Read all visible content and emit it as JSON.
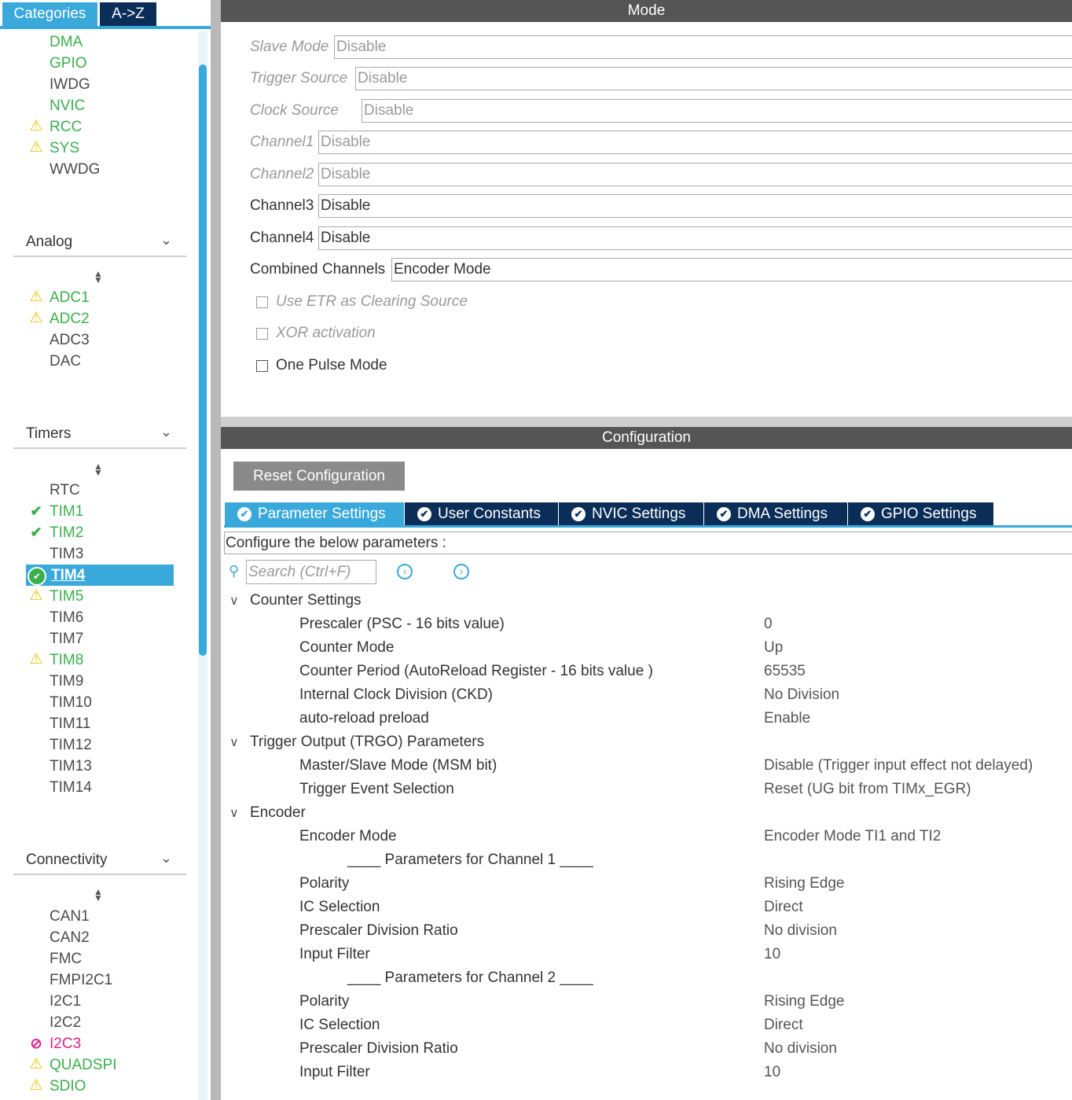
{
  "sidebar": {
    "tabs": {
      "categories": "Categories",
      "az": "A->Z"
    },
    "system_items": [
      {
        "label": "DMA",
        "status": "ok"
      },
      {
        "label": "GPIO",
        "status": "ok"
      },
      {
        "label": "IWDG",
        "status": "none"
      },
      {
        "label": "NVIC",
        "status": "ok"
      },
      {
        "label": "RCC",
        "status": "warning"
      },
      {
        "label": "SYS",
        "status": "warning"
      },
      {
        "label": "WWDG",
        "status": "none"
      }
    ],
    "analog": {
      "title": "Analog",
      "items": [
        {
          "label": "ADC1",
          "status": "warning"
        },
        {
          "label": "ADC2",
          "status": "warning"
        },
        {
          "label": "ADC3",
          "status": "none"
        },
        {
          "label": "DAC",
          "status": "none"
        }
      ]
    },
    "timers": {
      "title": "Timers",
      "items": [
        {
          "label": "RTC",
          "status": "none"
        },
        {
          "label": "TIM1",
          "status": "configured"
        },
        {
          "label": "TIM2",
          "status": "configured"
        },
        {
          "label": "TIM3",
          "status": "none"
        },
        {
          "label": "TIM4",
          "status": "selected"
        },
        {
          "label": "TIM5",
          "status": "warning"
        },
        {
          "label": "TIM6",
          "status": "none"
        },
        {
          "label": "TIM7",
          "status": "none"
        },
        {
          "label": "TIM8",
          "status": "warning"
        },
        {
          "label": "TIM9",
          "status": "none"
        },
        {
          "label": "TIM10",
          "status": "none"
        },
        {
          "label": "TIM11",
          "status": "none"
        },
        {
          "label": "TIM12",
          "status": "none"
        },
        {
          "label": "TIM13",
          "status": "none"
        },
        {
          "label": "TIM14",
          "status": "none"
        }
      ]
    },
    "connectivity": {
      "title": "Connectivity",
      "items": [
        {
          "label": "CAN1",
          "status": "none"
        },
        {
          "label": "CAN2",
          "status": "none"
        },
        {
          "label": "FMC",
          "status": "none"
        },
        {
          "label": "FMPI2C1",
          "status": "none"
        },
        {
          "label": "I2C1",
          "status": "none"
        },
        {
          "label": "I2C2",
          "status": "none"
        },
        {
          "label": "I2C3",
          "status": "conflict"
        },
        {
          "label": "QUADSPI",
          "status": "warning"
        },
        {
          "label": "SDIO",
          "status": "warning"
        }
      ]
    }
  },
  "mode": {
    "header": "Mode",
    "fields": [
      {
        "label": "Slave Mode",
        "value": "Disable",
        "enabled": false
      },
      {
        "label": "Trigger Source",
        "value": "Disable",
        "enabled": false
      },
      {
        "label": "Clock Source",
        "value": "Disable",
        "enabled": false
      },
      {
        "label": "Channel1",
        "value": "Disable",
        "enabled": false
      },
      {
        "label": "Channel2",
        "value": "Disable",
        "enabled": false
      },
      {
        "label": "Channel3",
        "value": "Disable",
        "enabled": true
      },
      {
        "label": "Channel4",
        "value": "Disable",
        "enabled": true
      },
      {
        "label": "Combined Channels",
        "value": "Encoder Mode",
        "enabled": true
      }
    ],
    "checkboxes": [
      {
        "label": "Use ETR as Clearing Source",
        "enabled": false,
        "checked": false
      },
      {
        "label": "XOR activation",
        "enabled": false,
        "checked": false
      },
      {
        "label": "One Pulse Mode",
        "enabled": true,
        "checked": false
      }
    ]
  },
  "configuration": {
    "header": "Configuration",
    "reset_label": "Reset Configuration",
    "tabs": [
      {
        "label": "Parameter Settings",
        "active": true
      },
      {
        "label": "User Constants",
        "active": false
      },
      {
        "label": "NVIC Settings",
        "active": false
      },
      {
        "label": "DMA Settings",
        "active": false
      },
      {
        "label": "GPIO Settings",
        "active": false
      }
    ],
    "instructions": "Configure the below parameters :",
    "search_placeholder": "Search (Ctrl+F)",
    "groups": [
      {
        "title": "Counter Settings",
        "params": [
          {
            "name": "Prescaler (PSC - 16 bits value)",
            "value": "0"
          },
          {
            "name": "Counter Mode",
            "value": "Up"
          },
          {
            "name": "Counter Period (AutoReload Register - 16 bits value )",
            "value": "65535"
          },
          {
            "name": "Internal Clock Division (CKD)",
            "value": "No Division"
          },
          {
            "name": "auto-reload preload",
            "value": "Enable"
          }
        ]
      },
      {
        "title": "Trigger Output (TRGO) Parameters",
        "params": [
          {
            "name": "Master/Slave Mode (MSM bit)",
            "value": "Disable (Trigger input effect not delayed)"
          },
          {
            "name": "Trigger Event Selection",
            "value": "Reset (UG bit from TIMx_EGR)"
          }
        ]
      },
      {
        "title": "Encoder",
        "params": [
          {
            "name": "Encoder Mode",
            "value": "Encoder Mode TI1 and TI2"
          },
          {
            "name": "____ Parameters for Channel 1 ____",
            "value": "",
            "sub": true
          },
          {
            "name": "Polarity",
            "value": "Rising Edge"
          },
          {
            "name": "IC Selection",
            "value": "Direct"
          },
          {
            "name": "Prescaler Division Ratio",
            "value": "No division"
          },
          {
            "name": "Input Filter",
            "value": "10"
          },
          {
            "name": "____ Parameters for Channel 2 ____",
            "value": "",
            "sub": true
          },
          {
            "name": "Polarity",
            "value": "Rising Edge"
          },
          {
            "name": "IC Selection",
            "value": "Direct"
          },
          {
            "name": "Prescaler Division Ratio",
            "value": "No division"
          },
          {
            "name": "Input Filter",
            "value": "10"
          }
        ]
      }
    ]
  },
  "colors": {
    "accent": "#39a9db",
    "dark_tab": "#0b2e58",
    "header_bg": "#555555",
    "ok_text": "#3aaf4b",
    "warning_icon": "#f0c000",
    "conflict": "#e0218a"
  }
}
